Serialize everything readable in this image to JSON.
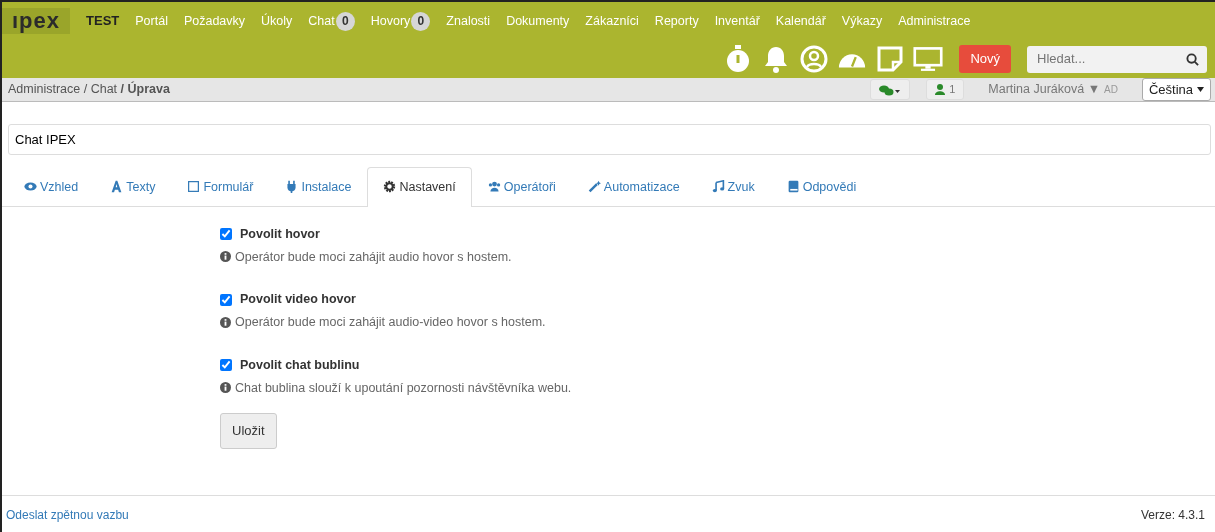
{
  "navbar": {
    "logo": "ıpex",
    "env": "TEST",
    "items": [
      {
        "label": "Portál"
      },
      {
        "label": "Požadavky"
      },
      {
        "label": "Úkoly"
      },
      {
        "label": "Chat",
        "badge": "0"
      },
      {
        "label": "Hovory",
        "badge": "0"
      },
      {
        "label": "Znalosti"
      },
      {
        "label": "Dokumenty"
      },
      {
        "label": "Zákazníci"
      },
      {
        "label": "Reporty"
      },
      {
        "label": "Inventář"
      },
      {
        "label": "Kalendář"
      },
      {
        "label": "Výkazy"
      },
      {
        "label": "Administrace"
      }
    ],
    "new_button": "Nový",
    "search": {
      "placeholder": "Hledat..."
    }
  },
  "breadcrumb": "Administrace / Chat **/ Úprava**",
  "status": {
    "online_count": "1",
    "user": "Martina Juráková ▼",
    "role": "AD",
    "language": "Čeština"
  },
  "name_field": {
    "value": "Chat IPEX"
  },
  "tabs": [
    {
      "label": "Vzhled",
      "selected": false
    },
    {
      "label": "Texty",
      "selected": false
    },
    {
      "label": "Formulář",
      "selected": false
    },
    {
      "label": "Instalace",
      "selected": false
    },
    {
      "label": "Nastavení",
      "selected": true
    },
    {
      "label": "Operátoři",
      "selected": false
    },
    {
      "label": "Automatizace",
      "selected": false
    },
    {
      "label": "Zvuk",
      "selected": false
    },
    {
      "label": "Odpovědi",
      "selected": false
    }
  ],
  "settings": [
    {
      "label": "Povolit hovor",
      "checked": true,
      "help": "Operátor bude moci zahájit audio hovor s hostem."
    },
    {
      "label": "Povolit video hovor",
      "checked": true,
      "help": "Operátor bude moci zahájit audio-video hovor s hostem."
    },
    {
      "label": "Povolit chat bublinu",
      "checked": true,
      "help": "Chat bublina slouží k upoutání pozornosti návštěvníka webu."
    }
  ],
  "save_button": "Uložit",
  "footer": {
    "feedback_link": "Odeslat zpětnou vazbu",
    "version": "Verze: 4.3.1"
  }
}
